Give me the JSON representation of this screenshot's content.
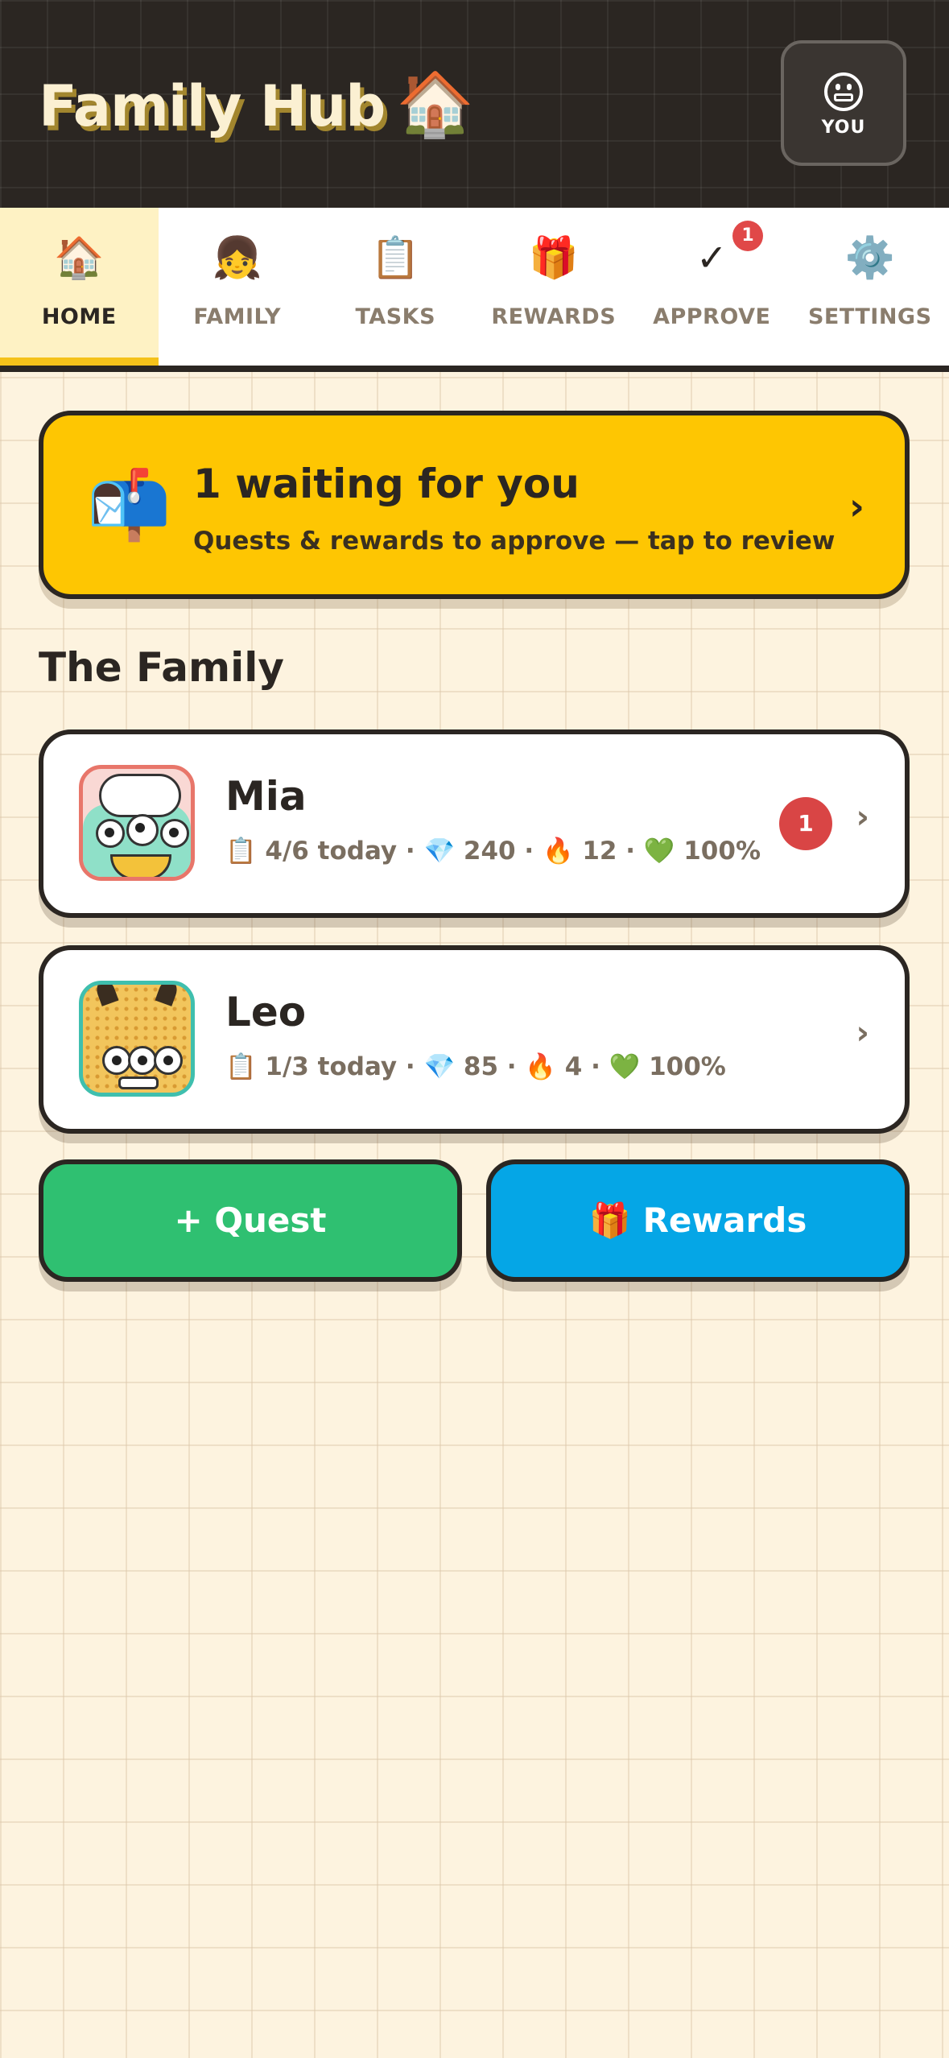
{
  "header": {
    "title": "Family Hub",
    "title_icon": "🏠",
    "profile_label": "YOU"
  },
  "tabs": [
    {
      "icon": "🏠",
      "label": "HOME",
      "active": true
    },
    {
      "icon": "👧",
      "label": "FAMILY"
    },
    {
      "icon": "📋",
      "label": "TASKS"
    },
    {
      "icon": "🎁",
      "label": "REWARDS"
    },
    {
      "icon": "✓",
      "label": "APPROVE",
      "badge": "1"
    },
    {
      "icon": "⚙️",
      "label": "SETTINGS"
    }
  ],
  "approval_banner": {
    "icon": "📬",
    "title": "1 waiting for you",
    "subtitle": "Quests & rewards to approve — tap to review",
    "chevron": "›"
  },
  "family_section": {
    "title": "The Family"
  },
  "members": [
    {
      "name": "Mia",
      "stats": "📋 4/6 today · 💎 240 · 🔥 12 · 💚 100%",
      "pending_badge": "1",
      "chevron": "›"
    },
    {
      "name": "Leo",
      "stats": "📋 1/3 today · 💎 85 · 🔥 4 · 💚 100%",
      "chevron": "›"
    }
  ],
  "actions": {
    "quest_label": "+ Quest",
    "rewards_label": "🎁 Rewards"
  },
  "colors": {
    "header_bg": "#2b2622",
    "page_bg": "#fdf3df",
    "banner_yellow": "#fec602",
    "quest_green": "#2fc071",
    "rewards_blue": "#05a6e6",
    "badge_red": "#d94545",
    "active_tab_accent": "#f5c21a"
  }
}
